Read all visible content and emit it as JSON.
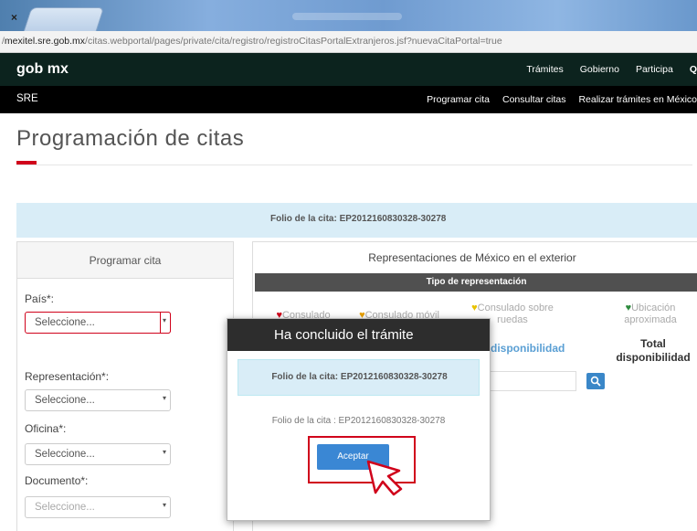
{
  "browser": {
    "tab_close": "×",
    "url_prefix": "/",
    "url_domain": "mexitel.sre.gob.mx",
    "url_path": "/citas.webportal/pages/private/cita/registro/registroCitasPortalExtranjeros.jsf?nuevaCitaPortal=true"
  },
  "gobnav": {
    "logo": "gob mx",
    "links": [
      "Trámites",
      "Gobierno",
      "Participa",
      "Q"
    ]
  },
  "srenav": {
    "title": "SRE",
    "links": [
      "Programar cita",
      "Consultar citas",
      "Realizar trámites en México"
    ]
  },
  "page": {
    "title": "Programación de citas",
    "folio_banner": "Folio de la cita: EP2012160830328-30278"
  },
  "left": {
    "header": "Programar cita",
    "fields": [
      {
        "label": "País*:",
        "value": "Seleccione..."
      },
      {
        "label": "Representación*:",
        "value": "Seleccione..."
      },
      {
        "label": "Oficina*:",
        "value": "Seleccione..."
      },
      {
        "label": "Documento*:",
        "value": "Seleccione..."
      }
    ]
  },
  "right": {
    "header": "Representaciones de México en el exterior",
    "tipo_header": "Tipo de representación",
    "legend": [
      {
        "pin": "♥",
        "label": "Consulado",
        "color": "#d0021b"
      },
      {
        "pin": "♥",
        "label": "Consulado móvil",
        "color": "#e8a000"
      },
      {
        "pin": "♥",
        "label": "Consulado sobre ruedas",
        "color": "#e8c200"
      },
      {
        "pin": "♥",
        "label": "Ubicación aproximada",
        "color": "#2e8b3e"
      }
    ],
    "col_disponibilidad": "disponibilidad",
    "col_total": "Total disponibilidad"
  },
  "modal": {
    "title": "Ha concluido el trámite",
    "alert": "Folio de la cita: EP2012160830328-30278",
    "text": "Folio de la cita : EP2012160830328-30278",
    "accept": "Aceptar"
  },
  "colors": {
    "gob_bar": "#0c231e",
    "accent_red": "#d0021b",
    "button_blue": "#3a87d4",
    "alert_blue": "#d9edf7"
  }
}
